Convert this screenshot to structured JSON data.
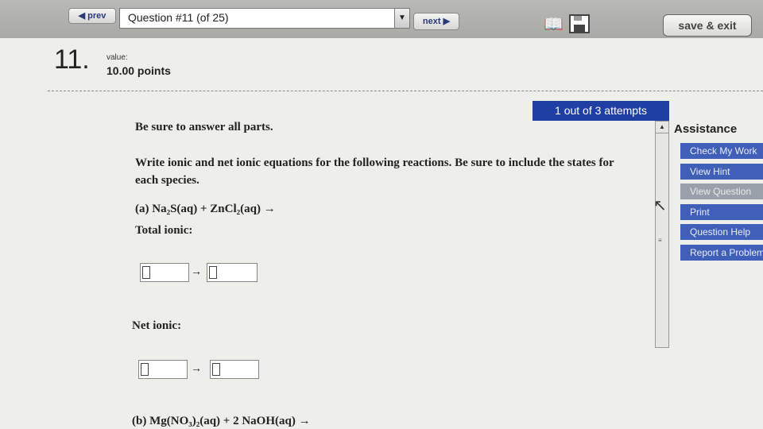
{
  "toolbar": {
    "prev_label": "◀ prev",
    "question_select": "Question #11 (of 25)",
    "next_label": "next ▶",
    "save_exit_label": "save & exit"
  },
  "question": {
    "number": "11.",
    "value_label": "value:",
    "points": "10.00 points",
    "attempts": "1 out of 3 attempts"
  },
  "content": {
    "instruction": "Be sure to answer all parts.",
    "prompt": "Write ionic and net ionic equations for the following reactions. Be sure to include the states for each species.",
    "part_a": "(a) Na₂S(aq) + ZnCl₂(aq) →",
    "total_ionic_label": "Total ionic:",
    "net_ionic_label": "Net ionic:",
    "part_b": "(b) Mg(NO₃)₂(aq) + 2 NaOH(aq) →",
    "arrow": "→"
  },
  "assistance": {
    "title": "Assistance",
    "buttons": [
      "Check My Work",
      "View Hint",
      "View Question",
      "Print",
      "Question Help",
      "Report a Problem"
    ]
  },
  "colors": {
    "accent": "#1f3fa2",
    "button": "#3f5fb8",
    "disabled": "#9aa0aa"
  },
  "icons": [
    "book-icon",
    "save-disk-icon",
    "arrow-cursor-icon"
  ]
}
